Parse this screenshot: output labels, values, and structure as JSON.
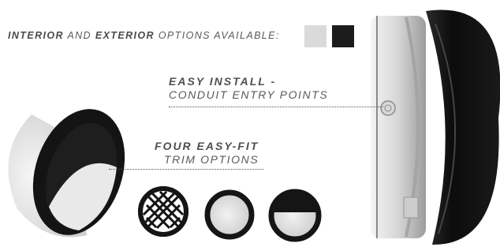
{
  "options": {
    "interior": "INTERIOR",
    "and": "AND",
    "exterior": "EXTERIOR",
    "rest": "OPTIONS AVAILABLE:",
    "swatches": [
      {
        "name": "light",
        "color": "#dadada"
      },
      {
        "name": "dark",
        "color": "#1c1c1c"
      }
    ]
  },
  "install": {
    "title": "EASY INSTALL -",
    "subtitle": "CONDUIT ENTRY POINTS"
  },
  "trim": {
    "title": "FOUR EASY-FIT",
    "subtitle": "TRIM OPTIONS"
  },
  "trim_icons": [
    "crosshatch-grille-trim-icon",
    "round-ring-trim-icon",
    "eyelid-trim-icon"
  ]
}
